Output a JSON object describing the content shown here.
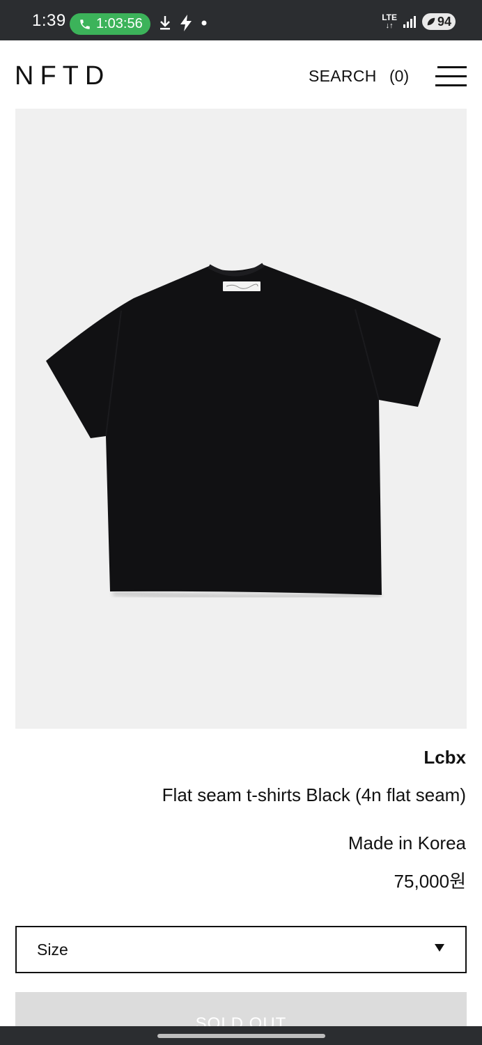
{
  "status_bar": {
    "time": "1:39",
    "call_timer": "1:03:56",
    "network": "LTE",
    "battery": "94"
  },
  "header": {
    "logo": "NFTD",
    "search_label": "SEARCH",
    "cart_count": "(0)"
  },
  "product": {
    "brand": "Lcbx",
    "name": "Flat seam t-shirts Black (4n flat seam)",
    "origin": "Made in Korea",
    "price": "75,000원",
    "size_select": {
      "selected": "Size"
    },
    "sold_out_label": "SOLD OUT"
  },
  "colors": {
    "status_bar_bg": "#2b2d30",
    "call_pill": "#3cb35a",
    "image_bg": "#f0f0f0",
    "tshirt": "#101012",
    "sold_out_bg": "#dcdcdc"
  },
  "icons": [
    "phone-icon",
    "download-icon",
    "charging-bolt-icon",
    "notification-dot-icon",
    "lte-icon",
    "signal-icon",
    "battery-icon",
    "menu-icon",
    "dropdown-caret-icon"
  ]
}
